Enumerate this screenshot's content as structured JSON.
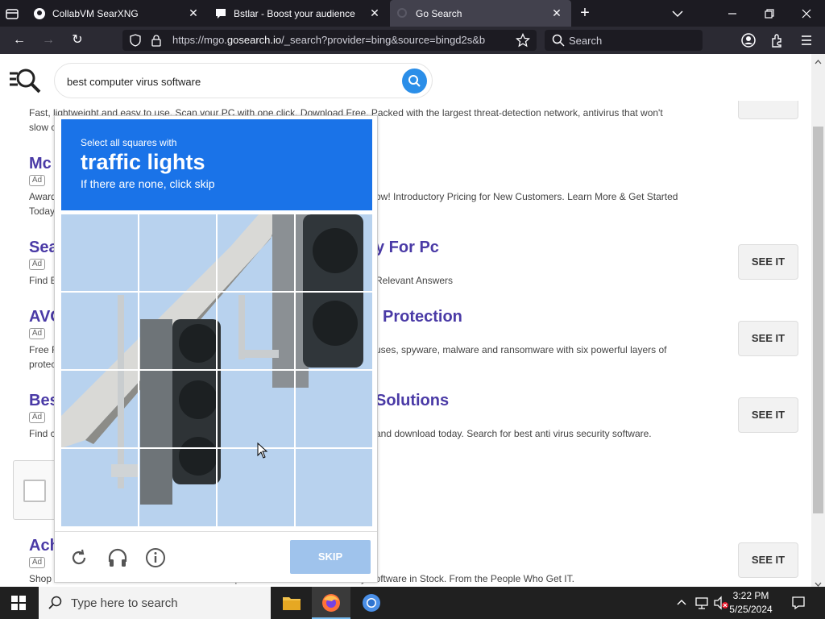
{
  "tabs": [
    {
      "title": "CollabVM SearXNG",
      "icon": "github-icon"
    },
    {
      "title": "Bstlar - Boost your audience",
      "icon": "chat-icon"
    },
    {
      "title": "Go Search",
      "icon": "gosearch-icon",
      "active": true
    }
  ],
  "address_bar": {
    "url_prefix": "https://mgo.",
    "url_host": "gosearch.io",
    "url_suffix": "/_search?provider=bing&source=bingd2s&b",
    "search_placeholder": "Search"
  },
  "page": {
    "query": "best computer virus software",
    "top_snippet": "Fast, lightweight and easy to use. Scan your PC with one click. Download Free. Packed with the largest threat-detection network, antivirus that won't",
    "top_snippet2": "slow c",
    "results": [
      {
        "title": "Mc",
        "desc": "Award",
        "desc_right": "ow! Introductory Pricing for New Customers. Learn More & Get Started",
        "desc2": "Today"
      },
      {
        "title": "Sea",
        "title_right": "y For Pc",
        "desc": "Find E",
        "desc_right": "Relevant Answers"
      },
      {
        "title": "AVG",
        "title_right": "Protection",
        "desc": "Free F",
        "desc_right": "uses, spyware, malware and ransomware with six powerful layers of",
        "desc2": "protec"
      },
      {
        "title": "Bes",
        "title_right": "Solutions",
        "desc": "Find c",
        "desc_right": "and download today. Search for best anti virus security software."
      },
      {
        "title": "Ach",
        "desc": "Shop Cisco Products & Solutions. From the People Who Get IT. Cisco Security Software in Stock. From the People Who Get IT."
      }
    ],
    "ad_label": "Ad",
    "see_it_label": "SEE IT"
  },
  "captcha": {
    "instruction": "Select all squares with",
    "target": "traffic lights",
    "hint": "If there are none, click skip",
    "skip_label": "SKIP"
  },
  "taskbar": {
    "search_placeholder": "Type here to search",
    "time": "3:22 PM",
    "date": "5/25/2024"
  }
}
